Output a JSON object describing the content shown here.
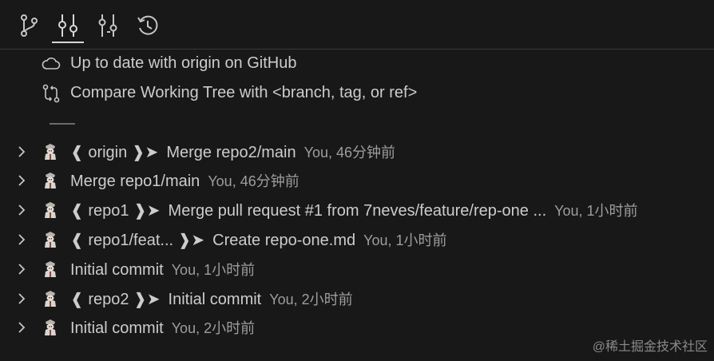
{
  "toolbar": {
    "tools": [
      {
        "name": "branches",
        "icon": "git-branch-icon",
        "active": false
      },
      {
        "name": "commits",
        "icon": "git-commit-icon",
        "active": true
      },
      {
        "name": "compare",
        "icon": "git-compare-icon",
        "active": false
      },
      {
        "name": "history",
        "icon": "history-icon",
        "active": false
      }
    ]
  },
  "status": {
    "upstream_text": "Up to date with origin on GitHub",
    "compare_text": "Compare Working Tree with <branch, tag, or ref>"
  },
  "commits": [
    {
      "ref": "❰ origin ❱➤",
      "message": "Merge repo2/main",
      "meta": "You, 46分钟前"
    },
    {
      "ref": "",
      "message": "Merge repo1/main",
      "meta": "You, 46分钟前"
    },
    {
      "ref": "❰ repo1 ❱➤",
      "message": "Merge pull request #1 from 7neves/feature/rep-one ...",
      "meta": "You, 1小时前"
    },
    {
      "ref": "❰ repo1/feat... ❱➤",
      "message": "Create repo-one.md",
      "meta": "You, 1小时前"
    },
    {
      "ref": "",
      "message": "Initial commit",
      "meta": "You, 1小时前"
    },
    {
      "ref": "❰ repo2 ❱➤",
      "message": "Initial commit",
      "meta": "You, 2小时前"
    },
    {
      "ref": "",
      "message": "Initial commit",
      "meta": "You, 2小时前"
    }
  ],
  "watermark": "@稀土掘金技术社区",
  "colors": {
    "background": "#181818",
    "text": "#cccccc",
    "meta": "#9d9d9d",
    "divider": "#3a3a3a"
  }
}
